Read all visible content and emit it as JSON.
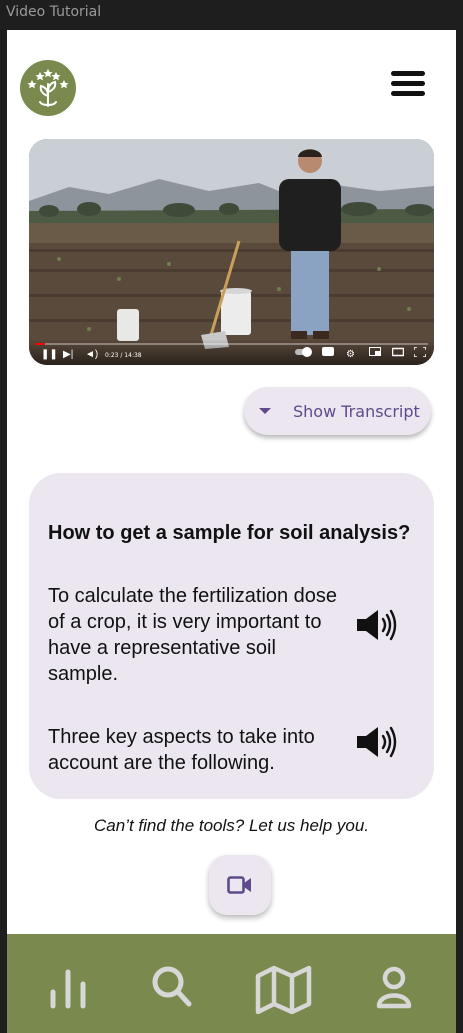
{
  "window": {
    "title": "Video Tutorial"
  },
  "header": {
    "logo_icon": "plant-stars-logo-icon",
    "menu_icon": "hamburger-menu-icon"
  },
  "video": {
    "time_label": "0:23 / 14:38",
    "progress_fraction": 0.026,
    "controls": [
      "play-pause-icon",
      "next-icon",
      "volume-icon",
      "autoplay-toggle-icon",
      "captions-icon",
      "settings-icon",
      "miniplayer-icon",
      "theater-icon",
      "fullscreen-icon"
    ]
  },
  "transcript_button": {
    "label": "Show Transcript",
    "icon": "triangle-down-icon"
  },
  "card": {
    "title": "How to get a sample for soil analysis?",
    "paragraphs": [
      "To calculate the fertilization dose of a crop, it is very important to have a representative soil sample.",
      "Three key aspects to take into account are the following."
    ]
  },
  "help": {
    "text": "Can’t find the tools? Let us help you."
  },
  "bottom_nav": {
    "items": [
      "bar-chart-icon",
      "search-icon",
      "map-icon",
      "person-icon"
    ]
  },
  "colors": {
    "brand_green": "#7a8a4e",
    "card_bg": "#ebe6f0",
    "accent_purple": "#5f4b8b"
  }
}
